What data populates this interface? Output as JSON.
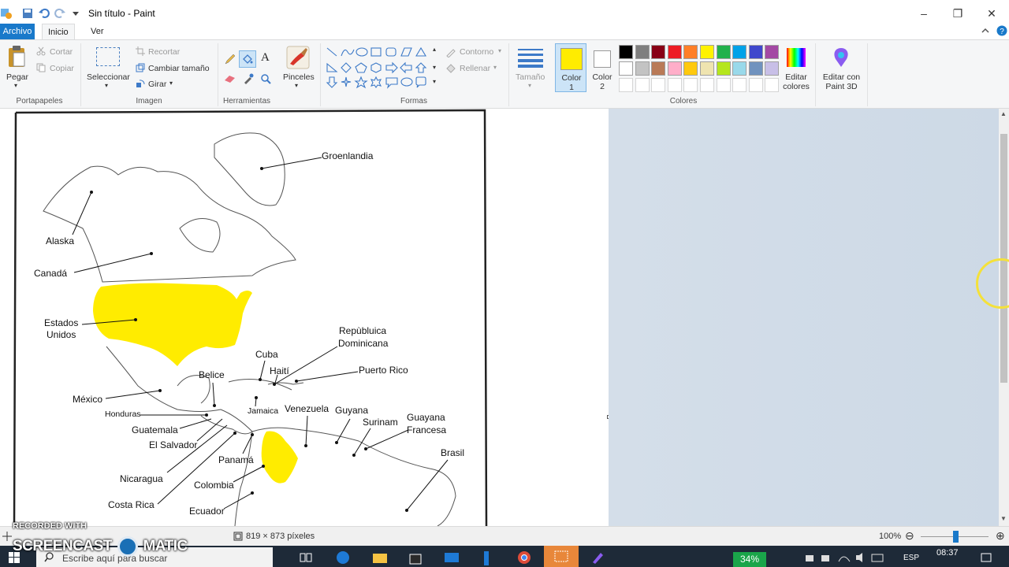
{
  "window": {
    "title": "Sin título - Paint",
    "minimize": "–",
    "restore": "❐",
    "close": "✕"
  },
  "tabs": [
    "Archivo",
    "Inicio",
    "Ver"
  ],
  "clipboard": {
    "paste": "Pegar",
    "cut": "Cortar",
    "copy": "Copiar",
    "group": "Portapapeles"
  },
  "image": {
    "select": "Seleccionar",
    "crop": "Recortar",
    "resize": "Cambiar tamaño",
    "rotate": "Girar",
    "group": "Imagen"
  },
  "tools": {
    "group": "Herramientas",
    "text_tool": "A"
  },
  "brushes": {
    "label": "Pinceles"
  },
  "shapes": {
    "outline": "Contorno",
    "fill": "Rellenar",
    "group": "Formas"
  },
  "size": {
    "label": "Tamaño"
  },
  "colors": {
    "color1": "Color 1",
    "color2": "Color 2",
    "color1_value": "#ffec00",
    "color2_value": "#ffffff",
    "edit_colors": "Editar colores",
    "edit_3d": "Editar con Paint 3D",
    "group": "Colores",
    "palette_row1": [
      "#000000",
      "#7f7f7f",
      "#880015",
      "#ed1c24",
      "#ff7f27",
      "#fff200",
      "#22b14c",
      "#00a2e8",
      "#3f48cc",
      "#a349a4"
    ],
    "palette_row2": [
      "#ffffff",
      "#c3c3c3",
      "#b97a57",
      "#ffaec9",
      "#ffc90e",
      "#efe4b0",
      "#b5e61d",
      "#99d9ea",
      "#7092be",
      "#c8bfe7"
    ]
  },
  "map_labels": {
    "groenlandia": "Groenlandia",
    "alaska": "Alaska",
    "canada": "Canadá",
    "estados_unidos_1": "Estados",
    "estados_unidos_2": "Unidos",
    "mexico": "México",
    "republica_1": "Repùbluica",
    "republica_2": "Dominicana",
    "cuba": "Cuba",
    "haiti": "Haití",
    "puerto_rico": "Puerto Rico",
    "belice": "Belice",
    "honduras": "Honduras",
    "jamaica": "Jamaica",
    "venezuela": "Venezuela",
    "guyana": "Guyana",
    "surinam": "Surinam",
    "guayana_1": "Guayana",
    "guayana_2": "Francesa",
    "guatemala": "Guatemala",
    "el_salvador": "El Salvador",
    "panama": "Panamá",
    "nicaragua": "Nicaragua",
    "colombia": "Colombia",
    "costa_rica": "Costa Rica",
    "ecuador": "Ecuador",
    "brasil": "Brasil"
  },
  "status": {
    "dimensions": "819 × 873 píxeles",
    "zoom": "100%",
    "zoom_minus": "⊖",
    "zoom_plus": "⊕",
    "zoom_level": 1.0
  },
  "taskbar": {
    "search_placeholder": "Escribe aquí para buscar",
    "battery": "34%",
    "lang": "ESP",
    "time": "08:37"
  },
  "watermark": {
    "line1": "RECORDED WITH",
    "line2": "SCREENCAST",
    "line3": "MATIC"
  }
}
